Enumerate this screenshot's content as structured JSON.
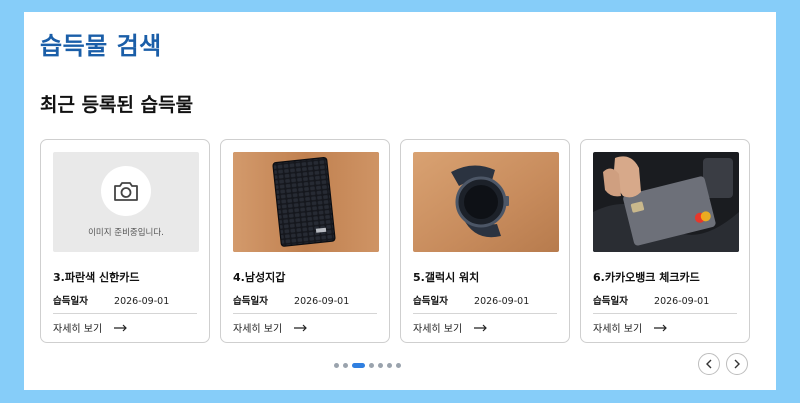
{
  "page": {
    "title": "습득물 검색",
    "section_title": "최근 등록된 습득물"
  },
  "cards": [
    {
      "title": "3.파란색 신한카드",
      "date_label": "습득일자",
      "date": "2026-09-01",
      "detail_label": "자세히 보기",
      "image": "placeholder",
      "placeholder_text": "이미지 준비중입니다."
    },
    {
      "title": "4.남성지갑",
      "date_label": "습득일자",
      "date": "2026-09-01",
      "detail_label": "자세히 보기",
      "image": "wallet-photo"
    },
    {
      "title": "5.갤럭시 워치",
      "date_label": "습득일자",
      "date": "2026-09-01",
      "detail_label": "자세히 보기",
      "image": "watch-photo"
    },
    {
      "title": "6.카카오뱅크 체크카드",
      "date_label": "습득일자",
      "date": "2026-09-01",
      "detail_label": "자세히 보기",
      "image": "card-photo"
    }
  ],
  "pagination": {
    "total": 7,
    "active": 3
  },
  "nav": {
    "prev_icon": "chevron-left-icon",
    "next_icon": "chevron-right-icon"
  },
  "colors": {
    "background": "#86cdf9",
    "title": "#1a5ea8",
    "active_dot": "#2f7fe0"
  }
}
